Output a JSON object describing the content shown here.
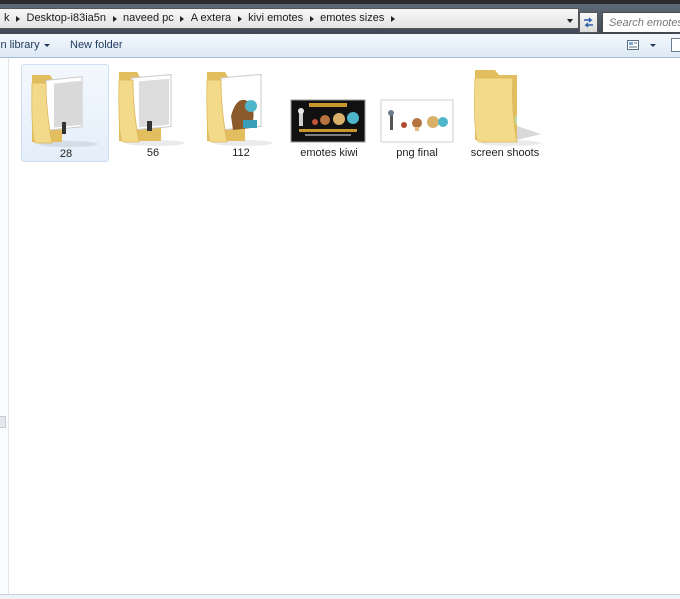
{
  "address_bar": {
    "crumbs": [
      "k",
      "Desktop-i83ia5n",
      "naveed pc",
      "A extera",
      "kivi emotes",
      "emotes sizes"
    ]
  },
  "search": {
    "placeholder": "Search emotes sizes"
  },
  "toolbar": {
    "include_library": "in library",
    "new_folder": "New folder"
  },
  "items": [
    {
      "label": "28",
      "type": "folder-with-images",
      "selected": true
    },
    {
      "label": "56",
      "type": "folder-with-images",
      "selected": false
    },
    {
      "label": "112",
      "type": "folder-with-images",
      "selected": false
    },
    {
      "label": "emotes kiwi",
      "type": "image-thumbnail-dark",
      "selected": false
    },
    {
      "label": "png final",
      "type": "image-thumbnail-light",
      "selected": false
    },
    {
      "label": "screen shoots",
      "type": "folder-empty",
      "selected": false
    }
  ],
  "colors": {
    "folder": "#f3d98a",
    "folder_shade": "#e2be5e",
    "selection": "#e4eefa",
    "toolbar_text": "#1e395b"
  }
}
